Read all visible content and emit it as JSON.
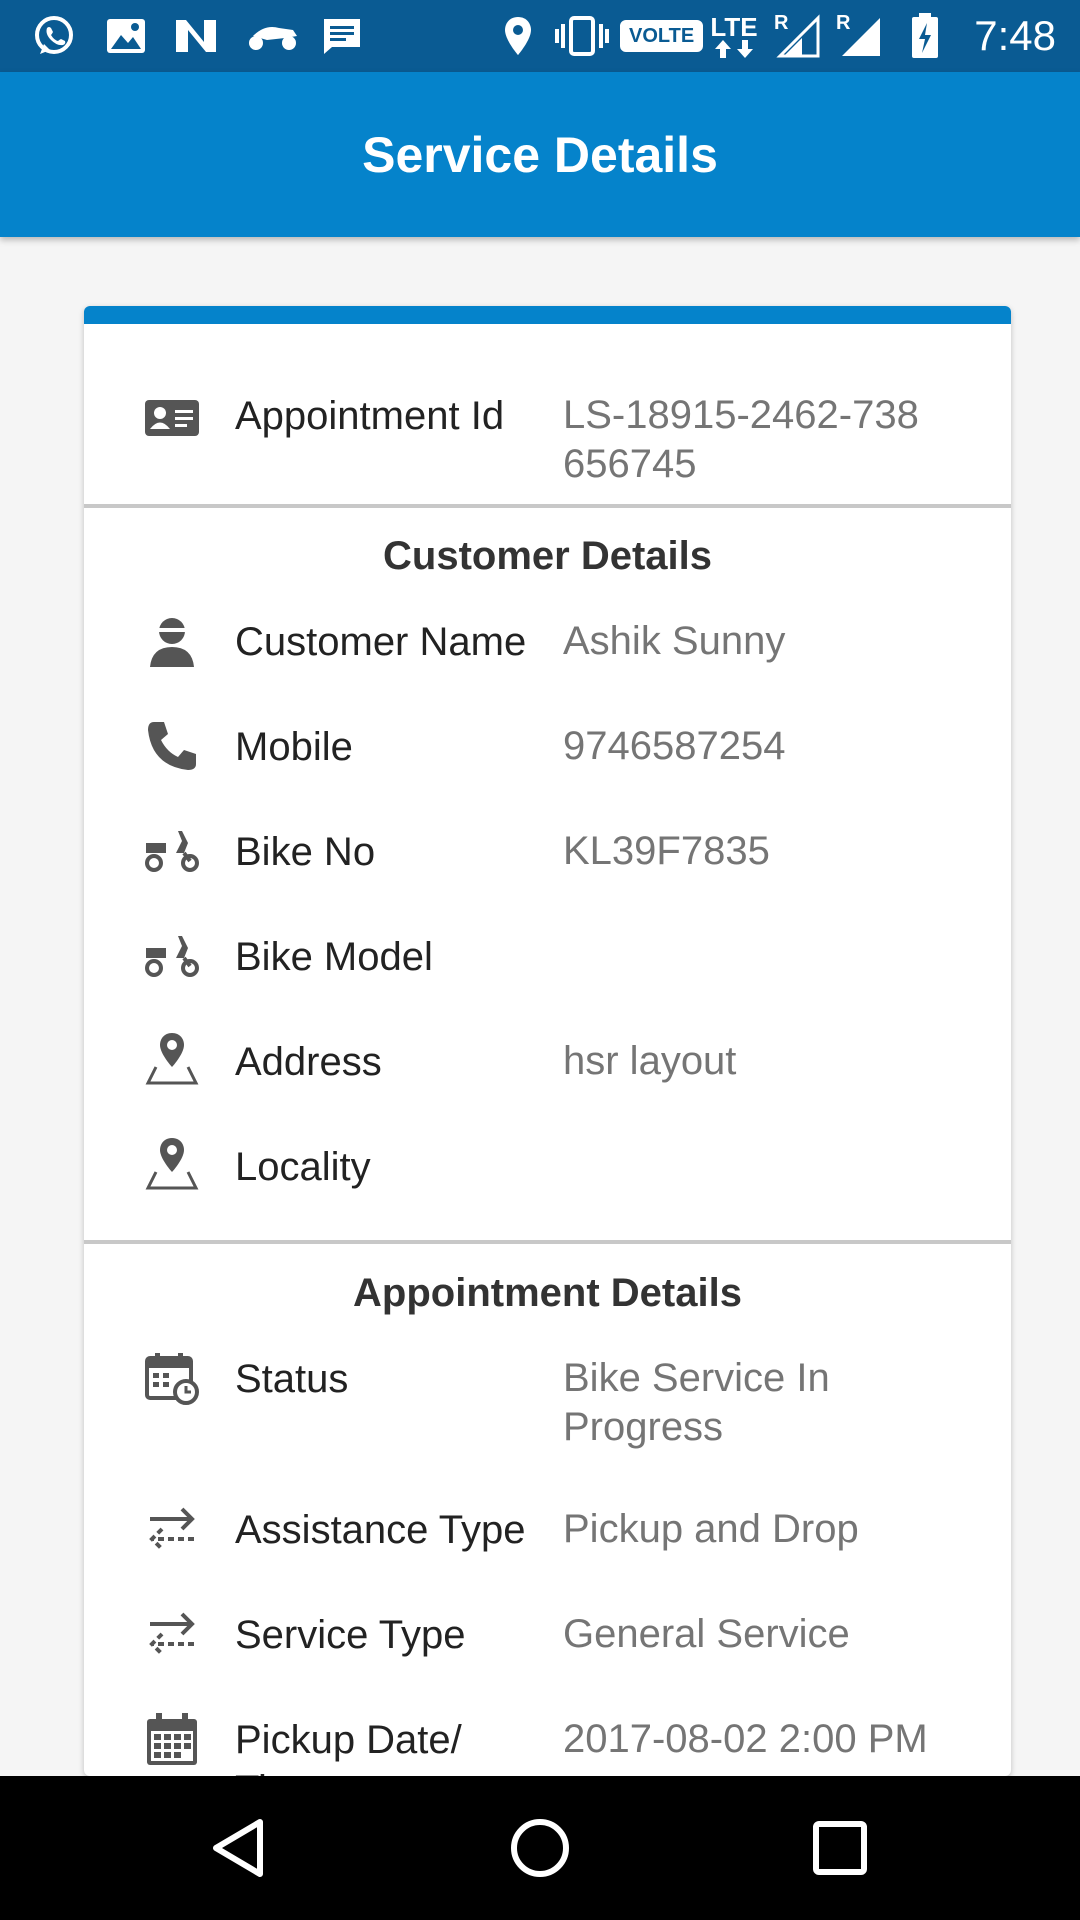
{
  "status_bar": {
    "time": "7:48",
    "volte_label": "VOLTE",
    "lte_label": "LTE",
    "roaming_1": "R",
    "roaming_2": "R"
  },
  "app_bar": {
    "title": "Service Details"
  },
  "card": {
    "appointment_id": {
      "label": "Appointment Id",
      "value": "LS-18915-2462-738 656745",
      "icon": "id-card-icon"
    },
    "customer_section": {
      "title": "Customer Details",
      "rows": [
        {
          "label": "Customer Name",
          "value": "Ashik Sunny",
          "icon": "person-icon"
        },
        {
          "label": "Mobile",
          "value": "9746587254",
          "icon": "phone-icon"
        },
        {
          "label": "Bike No",
          "value": "KL39F7835",
          "icon": "scooter-icon"
        },
        {
          "label": "Bike Model",
          "value": "",
          "icon": "scooter-icon"
        },
        {
          "label": "Address",
          "value": "hsr layout",
          "icon": "map-pin-icon"
        },
        {
          "label": "Locality",
          "value": "",
          "icon": "map-pin-icon"
        }
      ]
    },
    "appointment_section": {
      "title": "Appointment Details",
      "rows": [
        {
          "label": "Status",
          "value": "Bike Service In Progress",
          "icon": "calendar-clock-icon"
        },
        {
          "label": "Assistance Type",
          "value": "Pickup and Drop",
          "icon": "swap-arrows-icon"
        },
        {
          "label": "Service Type",
          "value": "General Service",
          "icon": "swap-arrows-icon"
        },
        {
          "label": "Pickup Date/ Time",
          "value": "2017-08-02 2:00 PM",
          "icon": "calendar-icon"
        }
      ]
    }
  },
  "colors": {
    "status_bar": "#0A5B93",
    "app_bar": "#0583CB",
    "accent": "#0583CB"
  }
}
